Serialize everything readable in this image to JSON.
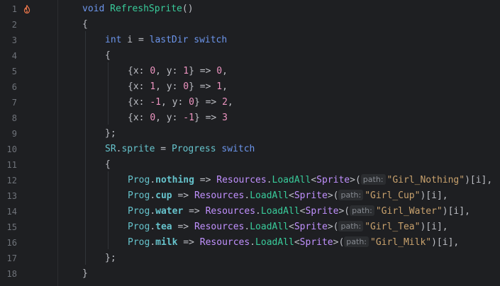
{
  "editor": {
    "line_numbers": [
      "1",
      "2",
      "3",
      "4",
      "5",
      "6",
      "7",
      "8",
      "9",
      "10",
      "11",
      "12",
      "13",
      "14",
      "15",
      "16",
      "17",
      "18"
    ],
    "gutter_icon": "fire-icon",
    "colors": {
      "background": "#1e1f22",
      "keyword": "#cf8e6d",
      "method": "#39cc9b",
      "type": "#c191ff",
      "number": "#ed94c0",
      "string": "#c9a26d",
      "property": "#66c3cc"
    },
    "code": {
      "l1": {
        "kw": "void",
        "name": "RefreshSprite",
        "rest": "()"
      },
      "l2": {
        "text": "{"
      },
      "l3": {
        "kw": "int",
        "rest1": " i = ",
        "var": "lastDir",
        "kw2": "switch"
      },
      "l4": {
        "text": "{"
      },
      "l5": {
        "a": "{x: ",
        "n1": "0",
        "b": ", y: ",
        "n2": "1",
        "c": "} => ",
        "n3": "0",
        "d": ","
      },
      "l6": {
        "a": "{x: ",
        "n1": "1",
        "b": ", y: ",
        "n2": "0",
        "c": "} => ",
        "n3": "1",
        "d": ","
      },
      "l7": {
        "a": "{x: ",
        "n1": "-1",
        "b": ", y: ",
        "n2": "0",
        "c": "} => ",
        "n3": "2",
        "d": ","
      },
      "l8": {
        "a": "{x: ",
        "n1": "0",
        "b": ", y: ",
        "n2": "-1",
        "c": "} => ",
        "n3": "3",
        "d": ""
      },
      "l9": {
        "text": "};"
      },
      "l10": {
        "obj": "SR",
        "prop": "sprite",
        "eq": " = ",
        "val": "Progress",
        "kw": "switch"
      },
      "l11": {
        "text": "{"
      },
      "l12": {
        "prog": "Prog",
        "field": "nothing",
        "arrow": " => ",
        "res": "Resources",
        "fn": "LoadAll",
        "ty": "Sprite",
        "hint": "path:",
        "str": "\"Girl_Nothing\"",
        "tail": ")[i],"
      },
      "l13": {
        "prog": "Prog",
        "field": "cup",
        "arrow": " => ",
        "res": "Resources",
        "fn": "LoadAll",
        "ty": "Sprite",
        "hint": "path:",
        "str": "\"Girl_Cup\"",
        "tail": ")[i],"
      },
      "l14": {
        "prog": "Prog",
        "field": "water",
        "arrow": " => ",
        "res": "Resources",
        "fn": "LoadAll",
        "ty": "Sprite",
        "hint": "path:",
        "str": "\"Girl_Water\"",
        "tail": ")[i],"
      },
      "l15": {
        "prog": "Prog",
        "field": "tea",
        "arrow": " => ",
        "res": "Resources",
        "fn": "LoadAll",
        "ty": "Sprite",
        "hint": "path:",
        "str": "\"Girl_Tea\"",
        "tail": ")[i],"
      },
      "l16": {
        "prog": "Prog",
        "field": "milk",
        "arrow": " => ",
        "res": "Resources",
        "fn": "LoadAll",
        "ty": "Sprite",
        "hint": "path:",
        "str": "\"Girl_Milk\"",
        "tail": ")[i],"
      },
      "l17": {
        "text": "};"
      },
      "l18": {
        "text": "}"
      }
    }
  }
}
